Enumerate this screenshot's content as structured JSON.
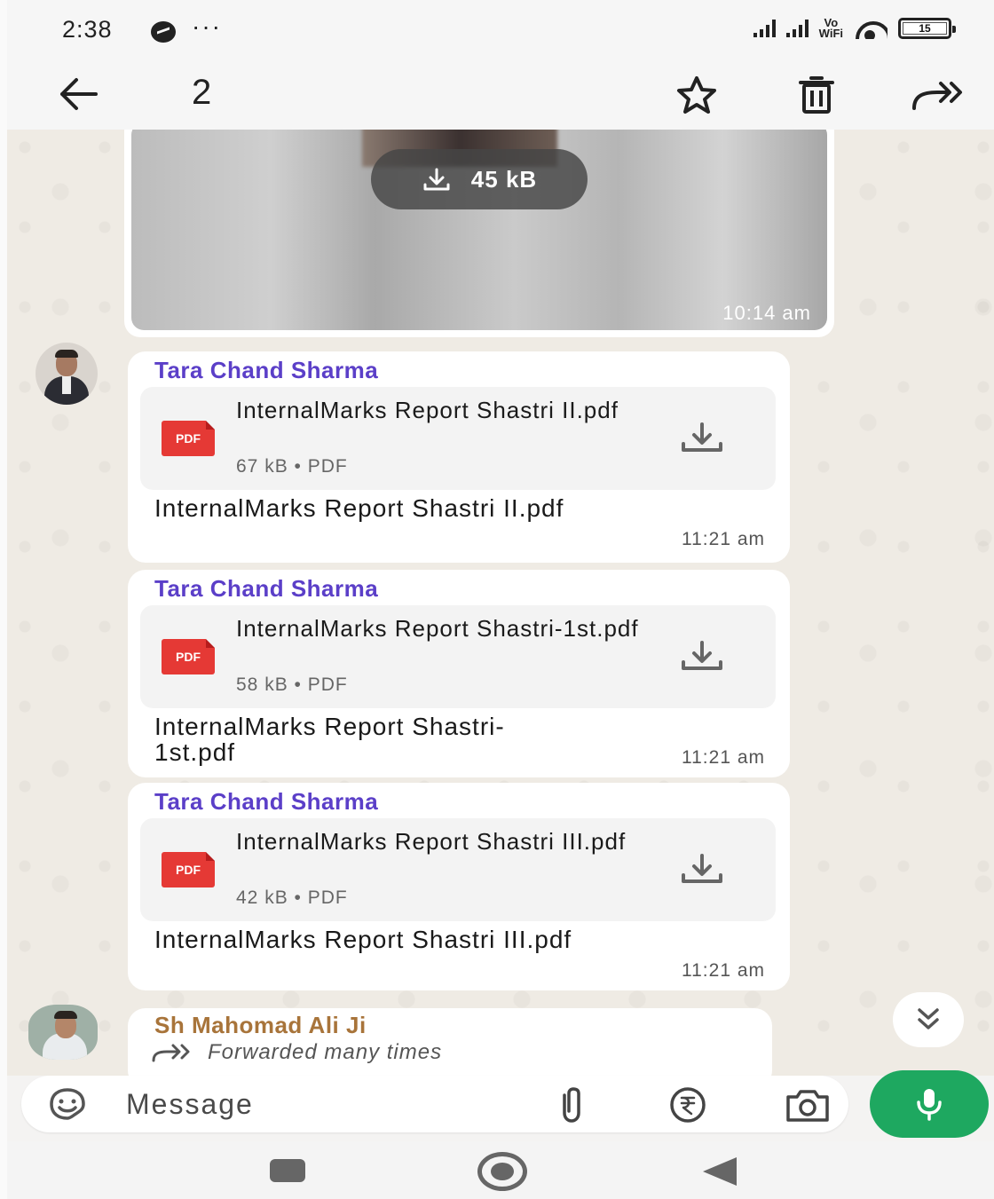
{
  "status_bar": {
    "time": "2:38",
    "overflow_dots": "···",
    "volte_label": "Vo\nWiFi",
    "battery_level": "15"
  },
  "action_bar": {
    "selected_count": "2",
    "icons": [
      "back-arrow-icon",
      "star-icon",
      "delete-icon",
      "forward-icon"
    ]
  },
  "chat": {
    "media_message": {
      "download_size": "45 kB",
      "time": "10:14 am"
    },
    "documents": [
      {
        "sender": "Tara Chand Sharma",
        "pdf_badge": "PDF",
        "file_name": "InternalMarks Report Shastri II.pdf",
        "meta": "67 kB • PDF",
        "caption": "InternalMarks Report  Shastri II.pdf",
        "time": "11:21 am"
      },
      {
        "sender": "Tara Chand Sharma",
        "pdf_badge": "PDF",
        "file_name": "InternalMarks Report Shastri-1st.pdf",
        "meta": "58 kB • PDF",
        "caption": "InternalMarks Report Shastri-1st.pdf",
        "time": "11:21 am"
      },
      {
        "sender": "Tara Chand Sharma",
        "pdf_badge": "PDF",
        "file_name": "InternalMarks Report Shastri III.pdf",
        "meta": "42 kB • PDF",
        "caption": "InternalMarks Report Shastri III.pdf",
        "time": "11:21 am"
      }
    ],
    "forwarded_message": {
      "sender": "Sh Mahomad Ali Ji",
      "tag": "Forwarded many times"
    }
  },
  "composer": {
    "placeholder": "Message"
  },
  "colors": {
    "sender_name": "#5b3fc8",
    "forwarded_sender": "#a8743a",
    "mic_button": "#1ea860",
    "pdf_badge": "#e53935"
  }
}
